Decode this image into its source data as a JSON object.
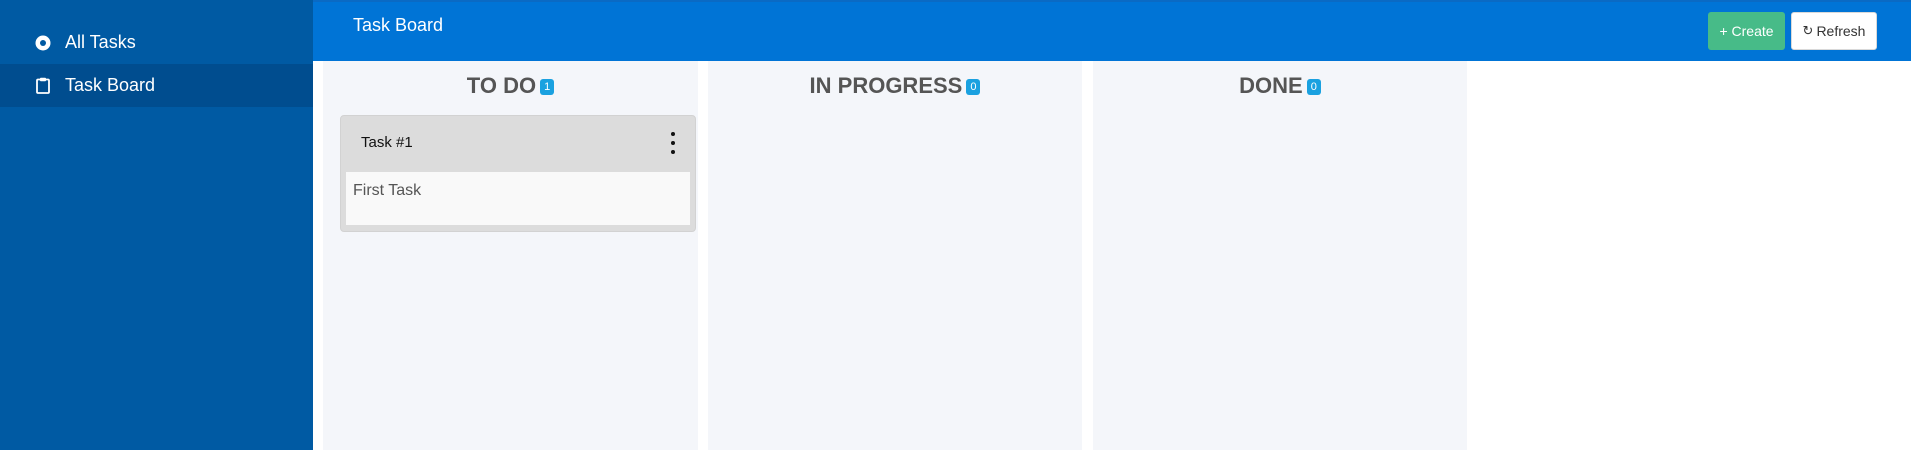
{
  "sidebar": {
    "items": [
      {
        "label": "All Tasks",
        "icon": "radio-dot-icon",
        "active": false
      },
      {
        "label": "Task Board",
        "icon": "clipboard-icon",
        "active": true
      }
    ]
  },
  "header": {
    "title": "Task Board",
    "create_label": "+ Create",
    "refresh_label": "Refresh"
  },
  "board": {
    "columns": [
      {
        "title": "TO DO",
        "count": "1",
        "cards": [
          {
            "title": "Task #1",
            "description": "First Task"
          }
        ]
      },
      {
        "title": "IN PROGRESS",
        "count": "0",
        "cards": []
      },
      {
        "title": "DONE",
        "count": "0",
        "cards": []
      }
    ]
  },
  "colors": {
    "sidebar": "#005aa3",
    "topbar": "#0074d6",
    "create_button": "#47bb88",
    "badge": "#1aa1e0",
    "column_bg": "#f4f6fa"
  }
}
